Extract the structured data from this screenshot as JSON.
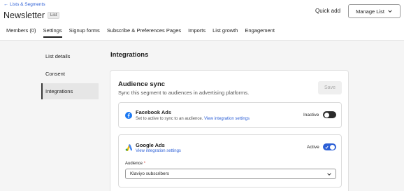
{
  "header": {
    "back_label": "Lists & Segments",
    "title": "Newsletter",
    "badge": "List",
    "quick_add": "Quick add",
    "manage_list": "Manage List"
  },
  "tabs": [
    {
      "label": "Members (0)"
    },
    {
      "label": "Settings"
    },
    {
      "label": "Signup forms"
    },
    {
      "label": "Subscribe & Preferences Pages"
    },
    {
      "label": "Imports"
    },
    {
      "label": "List growth"
    },
    {
      "label": "Engagement"
    }
  ],
  "active_tab": "Settings",
  "sidebar": {
    "items": [
      {
        "label": "List details"
      },
      {
        "label": "Consent"
      },
      {
        "label": "Integrations"
      }
    ],
    "active": "Integrations"
  },
  "section_title": "Integrations",
  "audience_sync": {
    "title": "Audience sync",
    "subtitle": "Sync this segment to audiences in advertising platforms.",
    "save_label": "Save",
    "facebook": {
      "name": "Facebook Ads",
      "desc": "Set to active to sync to an audience.",
      "link": "View integration settings",
      "status": "Inactive",
      "icon": "facebook-icon"
    },
    "google": {
      "name": "Google Ads",
      "link": "View integration settings",
      "status": "Active",
      "icon": "google-ads-icon",
      "audience_label": "Audience",
      "audience_required": "*",
      "audience_value": "Klaviyo subscribers"
    }
  },
  "colors": {
    "link": "#2c5fd6",
    "toggle_active": "#2c5fd6",
    "toggle_inactive": "#2b2b2b",
    "facebook": "#1877f2",
    "required": "#d0342c"
  }
}
